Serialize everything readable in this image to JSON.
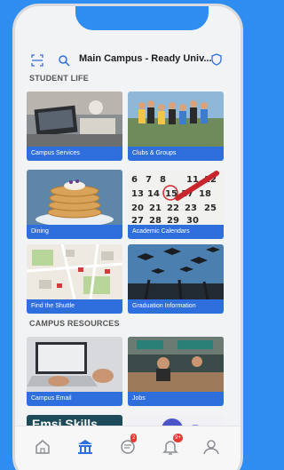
{
  "header": {
    "title": "Main Campus - Ready Univ..."
  },
  "sections": [
    {
      "title": "STUDENT LIFE"
    },
    {
      "title": "CAMPUS RESOURCES"
    }
  ],
  "tiles": [
    {
      "label": "Campus Services"
    },
    {
      "label": "Clubs & Groups"
    },
    {
      "label": "Dining"
    },
    {
      "label": "Academic Calendars"
    },
    {
      "label": "Find the Shuttle"
    },
    {
      "label": "Graduation Information"
    },
    {
      "label": "Campus Email"
    },
    {
      "label": "Jobs"
    },
    {
      "label": "Emsi Skills"
    },
    {
      "label": ""
    }
  ],
  "tabbar": {
    "inbox_badge": "2",
    "notifications_badge": "9+"
  },
  "colors": {
    "accent": "#2f8cf0",
    "tile_label_bg": "#2f6fdd",
    "badge": "#e53935"
  }
}
